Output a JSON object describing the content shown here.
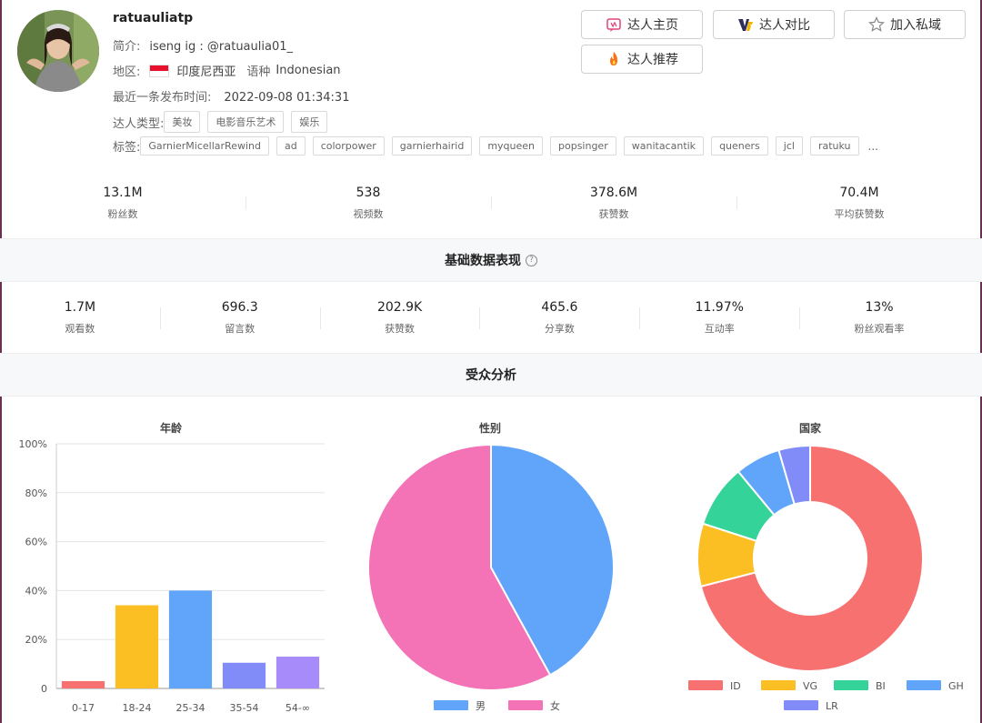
{
  "profile": {
    "name": "ratuauliatp",
    "bio_label": "简介:",
    "bio": "iseng ig : @ratuaulia01_",
    "region_label": "地区:",
    "region": "印度尼西亚",
    "language_label": "语种",
    "language": "Indonesian",
    "latest_label": "最近一条发布时间:",
    "latest": "2022-09-08 01:34:31",
    "types_label": "达人类型:",
    "types": [
      "美妆",
      "电影音乐艺术",
      "娱乐"
    ],
    "tags_label": "标签:",
    "tags": [
      "GarnierMicellarRewind",
      "ad",
      "colorpower",
      "garnierhairid",
      "myqueen",
      "popsinger",
      "wanitacantik",
      "queners",
      "jcl",
      "ratuku"
    ],
    "tags_more": "..."
  },
  "buttons": {
    "home": "达人主页",
    "compare": "达人对比",
    "private": "加入私域",
    "recommend": "达人推荐"
  },
  "overview": [
    {
      "value": "13.1M",
      "label": "粉丝数"
    },
    {
      "value": "538",
      "label": "视频数"
    },
    {
      "value": "378.6M",
      "label": "获赞数"
    },
    {
      "value": "70.4M",
      "label": "平均获赞数"
    }
  ],
  "basic_section": {
    "title": "基础数据表现",
    "help": "?"
  },
  "basic": [
    {
      "value": "1.7M",
      "label": "观看数"
    },
    {
      "value": "696.3",
      "label": "留言数"
    },
    {
      "value": "202.9K",
      "label": "获赞数"
    },
    {
      "value": "465.6",
      "label": "分享数"
    },
    {
      "value": "11.97%",
      "label": "互动率"
    },
    {
      "value": "13%",
      "label": "粉丝观看率"
    }
  ],
  "audience_section": {
    "title": "受众分析"
  },
  "chart_data": [
    {
      "type": "bar",
      "title": "年龄",
      "categories": [
        "0-17",
        "18-24",
        "25-34",
        "35-54",
        "54-∞"
      ],
      "values": [
        3,
        34,
        40,
        10.5,
        13
      ],
      "colors": [
        "#f87171",
        "#fbbf24",
        "#60a5fa",
        "#818cf8",
        "#a78bfa"
      ],
      "ylim": [
        0,
        100
      ],
      "yticks": [
        "0",
        "20%",
        "40%",
        "60%",
        "80%",
        "100%"
      ],
      "grid": true
    },
    {
      "type": "pie",
      "title": "性别",
      "series": [
        {
          "name": "男",
          "value": 42,
          "color": "#60a5fa"
        },
        {
          "name": "女",
          "value": 58,
          "color": "#f472b6"
        }
      ],
      "legend": "bottom"
    },
    {
      "type": "pie",
      "title": "国家",
      "donut": true,
      "series": [
        {
          "name": "ID",
          "value": 71,
          "color": "#f87171"
        },
        {
          "name": "VG",
          "value": 9,
          "color": "#fbbf24"
        },
        {
          "name": "BI",
          "value": 9,
          "color": "#34d399"
        },
        {
          "name": "GH",
          "value": 6.5,
          "color": "#60a5fa"
        },
        {
          "name": "LR",
          "value": 4.5,
          "color": "#818cf8"
        }
      ],
      "legend": "bottom"
    }
  ]
}
